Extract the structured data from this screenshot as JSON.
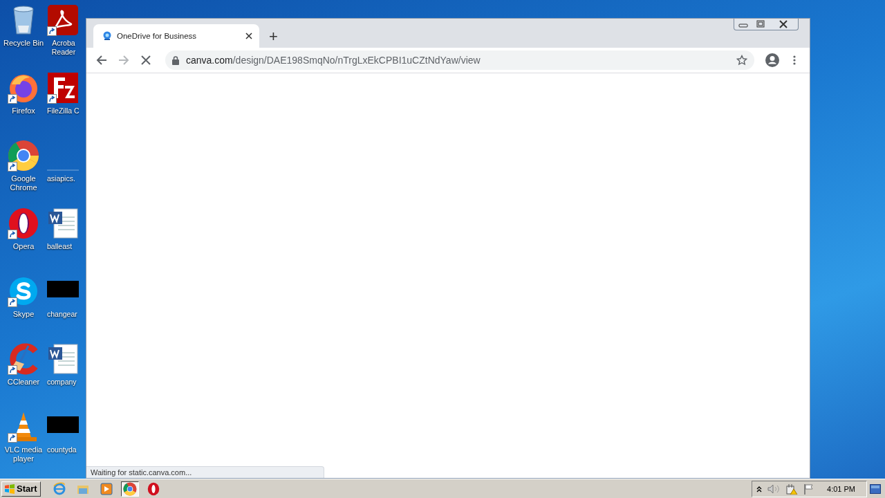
{
  "desktop": {
    "icons": [
      {
        "label": "Recycle Bin",
        "kind": "recycle-bin",
        "shortcut": false
      },
      {
        "label": "Acroba Reader",
        "kind": "acrobat",
        "shortcut": true
      },
      {
        "label": "Firefox",
        "kind": "firefox",
        "shortcut": true
      },
      {
        "label": "FileZilla C",
        "kind": "filezilla",
        "shortcut": true
      },
      {
        "label": "Google Chrome",
        "kind": "chrome",
        "shortcut": true
      },
      {
        "label": "asiapics.",
        "kind": "blank",
        "shortcut": false
      },
      {
        "label": "Opera",
        "kind": "opera",
        "shortcut": true
      },
      {
        "label": "balleast",
        "kind": "word",
        "shortcut": false
      },
      {
        "label": "Skype",
        "kind": "skype",
        "shortcut": true
      },
      {
        "label": "changear",
        "kind": "black",
        "shortcut": false
      },
      {
        "label": "CCleaner",
        "kind": "ccleaner",
        "shortcut": true
      },
      {
        "label": "company",
        "kind": "word",
        "shortcut": false
      },
      {
        "label": "VLC media player",
        "kind": "vlc",
        "shortcut": true
      },
      {
        "label": "countyda",
        "kind": "black",
        "shortcut": false
      }
    ]
  },
  "browser": {
    "tabs": [
      {
        "title": "OneDrive for Business",
        "selected": true
      }
    ],
    "new_tab": "+",
    "address": {
      "host": "canva.com",
      "path": "/design/DAE198SmqNo/nTrgLxEkCPBI1uCZtNdYaw/view",
      "secure": true
    },
    "loading": true,
    "status": "Waiting for static.canva.com..."
  },
  "taskbar": {
    "start": "Start",
    "apps": [
      {
        "kind": "ie",
        "selected": false
      },
      {
        "kind": "explorer",
        "selected": false
      },
      {
        "kind": "media",
        "selected": false
      },
      {
        "kind": "chrome",
        "selected": true
      },
      {
        "kind": "opera",
        "selected": false
      }
    ],
    "clock": "4:01 PM"
  }
}
